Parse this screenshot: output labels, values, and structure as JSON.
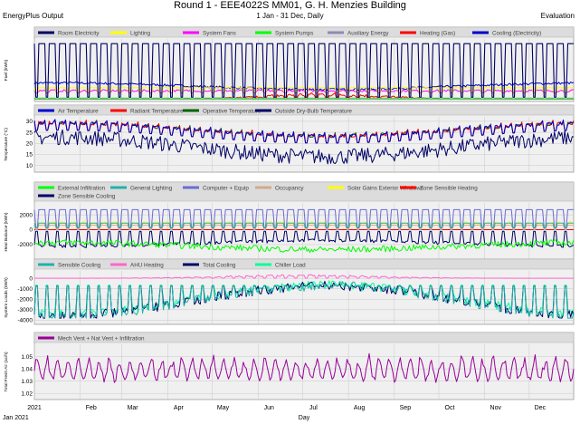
{
  "header": {
    "title": "Round 1 - EEE4022S MM01, G. H. Menzies Building",
    "app": "EnergyPlus Output",
    "range": "1 Jan - 31 Dec, Daily",
    "status": "Evaluation"
  },
  "x_axis": {
    "months": [
      "2021",
      "Feb",
      "Mar",
      "Apr",
      "May",
      "Jun",
      "Jul",
      "Aug",
      "Sep",
      "Oct",
      "Nov",
      "Dec"
    ],
    "year_label": "Jan  2021",
    "title": "Day"
  },
  "chart_data": [
    {
      "type": "line",
      "ylabel": "Fuel (kWh)",
      "ylim": [
        -150,
        3800
      ],
      "yticks": [],
      "legend_placement": "top",
      "grid": true,
      "series": [
        {
          "name": "Room Electricity",
          "color": "#000066",
          "pattern": "square",
          "low": 120,
          "high": 3500
        },
        {
          "name": "Lighting",
          "color": "#ffff00",
          "pattern": "square",
          "low": 330,
          "high": 720
        },
        {
          "name": "System Fans",
          "color": "#ff00ff",
          "pattern": "noisy",
          "low": 380,
          "high": 600
        },
        {
          "name": "System Pumps",
          "color": "#00ff00",
          "pattern": "square",
          "low": 20,
          "high": 60
        },
        {
          "name": "Auxiliary Energy",
          "color": "#8c8cb4",
          "pattern": "flat",
          "low": 0,
          "high": 0
        },
        {
          "name": "Heating (Gas)",
          "color": "#ff0000",
          "pattern": "summerbumps",
          "low": 0,
          "high": 420
        },
        {
          "name": "Cooling (Electricity)",
          "color": "#0000cc",
          "pattern": "smooth",
          "low": 350,
          "high": 1100
        }
      ]
    },
    {
      "type": "line",
      "ylabel": "Temperature (°C)",
      "ylim": [
        7,
        32
      ],
      "yticks": [
        10,
        15,
        20,
        25,
        30
      ],
      "legend_placement": "top",
      "grid": true,
      "series": [
        {
          "name": "Air Temperature",
          "color": "#0000cc",
          "pattern": "seasonal",
          "low": 21,
          "high": 30
        },
        {
          "name": "Radiant Temperature",
          "color": "#ff0000",
          "pattern": "seasonal",
          "low": 21,
          "high": 30
        },
        {
          "name": "Operative Temperature",
          "color": "#006400",
          "pattern": "seasonal",
          "low": 21,
          "high": 30
        },
        {
          "name": "Outside Dry-Bulb Temperature",
          "color": "#000066",
          "pattern": "outdoor",
          "low": 10,
          "high": 26
        }
      ]
    },
    {
      "type": "line",
      "ylabel": "Heat Balance (kWh)",
      "ylim": [
        -4200,
        3600
      ],
      "yticks": [
        -2000,
        0,
        2000
      ],
      "legend_placement": "top",
      "grid": true,
      "series": [
        {
          "name": "External Infiltration",
          "color": "#00ff00",
          "pattern": "negnoisy",
          "low": -3400,
          "high": -1300
        },
        {
          "name": "General Lighting",
          "color": "#20b2aa",
          "pattern": "square",
          "low": 200,
          "high": 900
        },
        {
          "name": "Computer + Equip",
          "color": "#6b6bd6",
          "pattern": "square",
          "low": 300,
          "high": 2700
        },
        {
          "name": "Occupancy",
          "color": "#d2aa8c",
          "pattern": "square",
          "low": 0,
          "high": 600
        },
        {
          "name": "Solar Gains Exterior Windows",
          "color": "#ffff00",
          "pattern": "noisy",
          "low": 500,
          "high": 1100
        },
        {
          "name": "Zone Sensible Heating",
          "color": "#ff0000",
          "pattern": "flat",
          "low": 0,
          "high": 0
        },
        {
          "name": "Zone Sensible Cooling",
          "color": "#000066",
          "pattern": "negsmooth",
          "low": -2600,
          "high": -1100
        }
      ]
    },
    {
      "type": "line",
      "ylabel": "System Loads (kWh)",
      "ylim": [
        -4400,
        700
      ],
      "yticks": [
        -4000,
        -3000,
        -2000,
        -1000,
        0
      ],
      "legend_placement": "top",
      "grid": true,
      "series": [
        {
          "name": "Sensible Cooling",
          "color": "#20b2aa",
          "pattern": "cooling",
          "low": -3800,
          "high": -200
        },
        {
          "name": "AHU Heating",
          "color": "#ff66cc",
          "pattern": "ahu",
          "low": 0,
          "high": 350
        },
        {
          "name": "Total Cooling",
          "color": "#000066",
          "pattern": "cooling",
          "low": -3800,
          "high": -200
        },
        {
          "name": "Chiller Load",
          "color": "#00ff99",
          "pattern": "cooling",
          "low": -3600,
          "high": -150
        }
      ]
    },
    {
      "type": "line",
      "ylabel": "Total Fresh Air (ac/h)",
      "ylim": [
        1.015,
        1.06
      ],
      "yticks": [
        1.02,
        1.03,
        1.04,
        1.05
      ],
      "legend_placement": "top",
      "grid": true,
      "series": [
        {
          "name": "Mech Vent + Nat Vent + Infiltration",
          "color": "#990099",
          "pattern": "vent",
          "low": 1.022,
          "high": 1.055
        }
      ]
    }
  ]
}
